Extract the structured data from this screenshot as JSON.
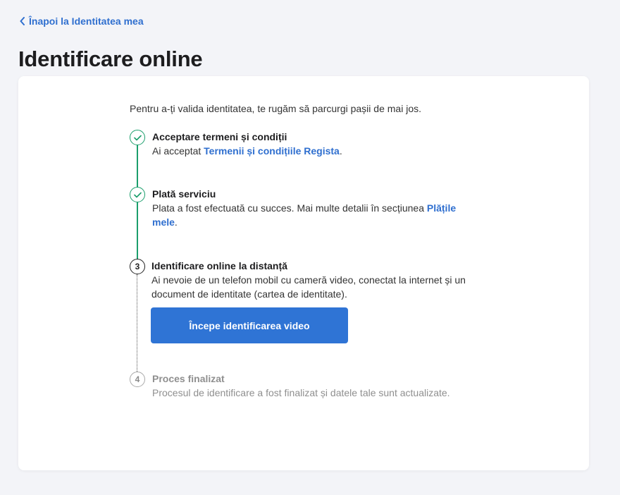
{
  "nav": {
    "back_label": "Înapoi la Identitatea mea"
  },
  "page": {
    "title": "Identificare online"
  },
  "card": {
    "intro": "Pentru a-ți valida identitatea, te rugăm să parcurgi pașii de mai jos.",
    "steps": [
      {
        "status": "done",
        "marker": "check-icon",
        "title": "Acceptare termeni și condiții",
        "desc_prefix": "Ai acceptat ",
        "desc_link": "Termenii și condițiile Regista",
        "desc_suffix": "."
      },
      {
        "status": "done",
        "marker": "check-icon",
        "title": "Plată serviciu",
        "desc_prefix": "Plata a fost efectuată cu succes. Mai multe detalii în secțiunea ",
        "desc_link": "Plățile mele",
        "desc_suffix": "."
      },
      {
        "status": "active",
        "number": "3",
        "title": "Identificare online la distanță",
        "desc": "Ai nevoie de un telefon mobil cu cameră video, conectat la internet și un document de identitate (cartea de identitate).",
        "button_label": "Începe identificarea video"
      },
      {
        "status": "pending",
        "number": "4",
        "title": "Proces finalizat",
        "desc": "Procesul de identificare a fost finalizat și datele tale sunt actualizate."
      }
    ]
  },
  "colors": {
    "accent": "#2f74d5",
    "link": "#2f6fcf",
    "success": "#1a9e6b",
    "muted": "#8f8f8f",
    "background": "#f3f4f8"
  }
}
